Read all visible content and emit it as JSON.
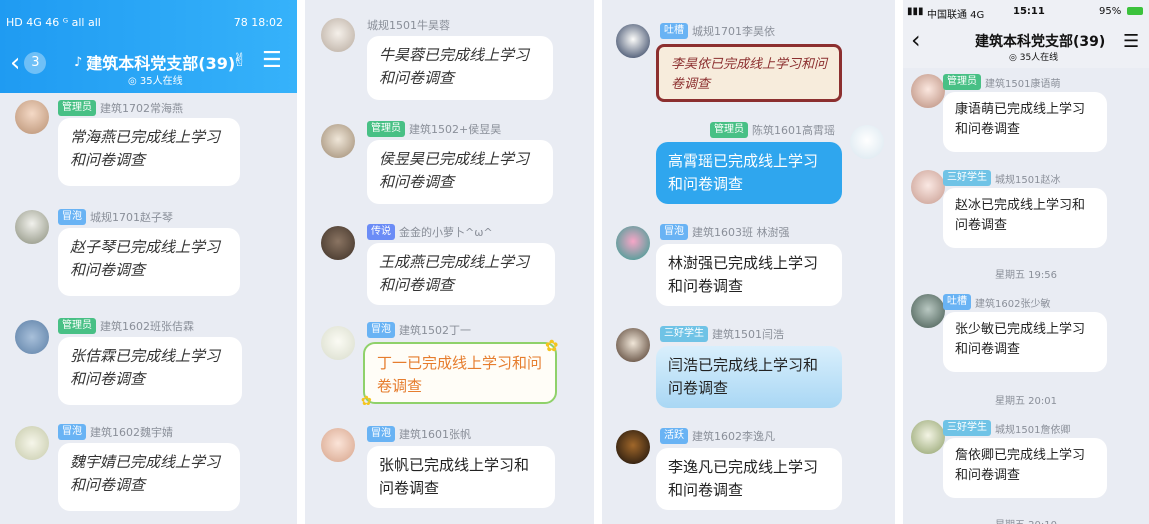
{
  "panel1": {
    "status": {
      "left": "HD 4G 46 ᴳ all all",
      "right": "78 18:02"
    },
    "back_count": "3",
    "title": "建筑本科党支部(39)",
    "online": "35人在线",
    "messages": [
      {
        "badge": "管理员",
        "badge_color": "#48c085",
        "sender": "建筑1702常海燕",
        "text": "常海燕已完成线上学习和问卷调查"
      },
      {
        "badge": "冒泡",
        "badge_color": "#69b3f4",
        "sender": "城规1701赵子琴",
        "text": "赵子琴已完成线上学习和问卷调查"
      },
      {
        "badge": "管理员",
        "badge_color": "#48c085",
        "sender": "建筑1602班张佶霖",
        "text": "张佶霖已完成线上学习和问卷调查"
      },
      {
        "badge": "冒泡",
        "badge_color": "#69b3f4",
        "sender": "建筑1602魏宇婧",
        "text": "魏宇婧已完成线上学习和问卷调查"
      }
    ]
  },
  "panel2": {
    "messages": [
      {
        "badge": "",
        "sender": "城规1501牛昊蓉",
        "text": "牛昊蓉已完成线上学习和问卷调查"
      },
      {
        "badge": "管理员",
        "badge_color": "#48c085",
        "sender": "建筑1502+侯昱昊",
        "text": "侯昱昊已完成线上学习和问卷调查"
      },
      {
        "badge": "传说",
        "badge_color": "#6b8cf6",
        "sender": "金金的小萝卜^ω^",
        "text": "王成燕已完成线上学习和问卷调查"
      },
      {
        "badge": "冒泡",
        "badge_color": "#69b3f4",
        "sender": "建筑1502丁一",
        "text": "丁一已完成线上学习和问卷调查"
      },
      {
        "badge": "冒泡",
        "badge_color": "#69b3f4",
        "sender": "建筑1601张帆",
        "text": "张帆已完成线上学习和问卷调查"
      }
    ]
  },
  "panel3": {
    "messages": [
      {
        "badge": "吐槽",
        "badge_color": "#69b3f4",
        "sender": "城规1701李昊依",
        "text": "李昊依已完成线上学习和问卷调查"
      },
      {
        "badge": "管理员",
        "badge_color": "#48c085",
        "sender": "陈筑1601高霄瑶",
        "text": "高霄瑶已完成线上学习和问卷调查"
      },
      {
        "badge": "冒泡",
        "badge_color": "#69b3f4",
        "sender": "建筑1603班 林澍强",
        "text": "林澍强已完成线上学习和问卷调查"
      },
      {
        "badge": "三好学生",
        "badge_color": "#6fc3e6",
        "sender": "建筑1501闫浩",
        "text": "闫浩已完成线上学习和问卷调查"
      },
      {
        "badge": "活跃",
        "badge_color": "#69b3f4",
        "sender": "建筑1602李逸凡",
        "text": "李逸凡已完成线上学习和问卷调查"
      }
    ]
  },
  "panel4": {
    "status": {
      "carrier": "中国联通 4G",
      "time": "15:11",
      "battery": "95%"
    },
    "title": "建筑本科党支部(39)",
    "online": "35人在线",
    "messages": [
      {
        "badge": "管理员",
        "badge_color": "#48c085",
        "sender": "建筑1501康语萌",
        "text": "康语萌已完成线上学习和问卷调查"
      },
      {
        "badge": "三好学生",
        "badge_color": "#6fc3e6",
        "sender": "城规1501赵冰",
        "text": "赵冰已完成线上学习和问卷调查"
      },
      {
        "badge": "吐槽",
        "badge_color": "#69b3f4",
        "sender": "建筑1602张少敏",
        "text": "张少敏已完成线上学习和问卷调查"
      },
      {
        "badge": "三好学生",
        "badge_color": "#6fc3e6",
        "sender": "城规1501詹依卿",
        "text": "詹依卿已完成线上学习和问卷调查"
      }
    ],
    "timestamps": [
      "星期五 19:56",
      "星期五 20:01",
      "星期五 20:10"
    ]
  }
}
